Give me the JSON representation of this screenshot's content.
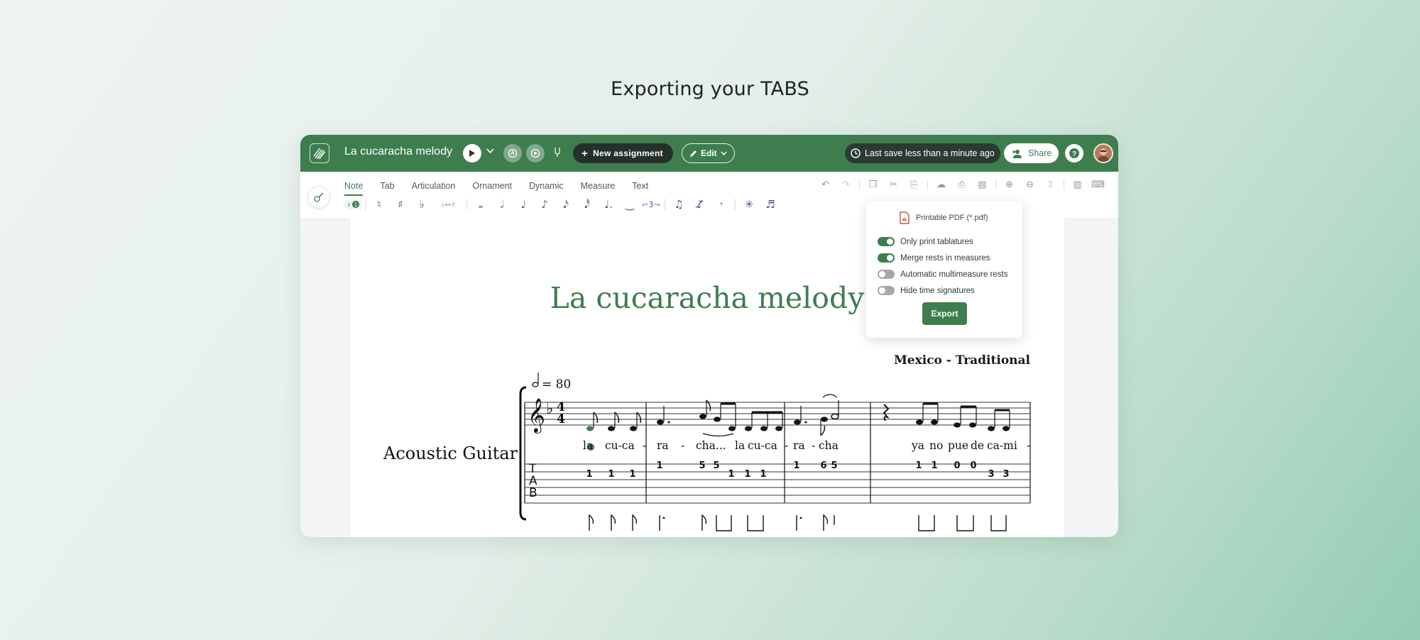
{
  "page": {
    "heading": "Exporting your TABS"
  },
  "app": {
    "doc_title": "La cucaracha melody",
    "new_assignment_label": "New assignment",
    "edit_label": "Edit",
    "save_status": "Last save less than a minute ago",
    "share_label": "Share",
    "accent_color": "#3e7d4e"
  },
  "toolbar": {
    "tabs": [
      "Note",
      "Tab",
      "Articulation",
      "Ornament",
      "Dynamic",
      "Measure",
      "Text"
    ],
    "active_tab": "Note",
    "voice_number": "1"
  },
  "score": {
    "title": "La cucaracha melody",
    "composer": "Mexico - Traditional",
    "instrument": "Acoustic Guitar",
    "tempo": "= 80",
    "tab_letters": [
      "T",
      "A",
      "B"
    ],
    "lyrics": [
      "la",
      "cu-ca",
      "-",
      "ra",
      "-",
      "cha...",
      "la",
      "cu-ca",
      "-",
      "ra",
      "-",
      "cha",
      "ya",
      "no",
      "pue",
      "de",
      "ca-mi",
      "-"
    ],
    "tab_numbers": [
      "1",
      "1",
      "1",
      "1",
      "5",
      "5",
      "1",
      "1",
      "1",
      "1",
      "6",
      "5",
      "1",
      "1",
      "0",
      "0",
      "3",
      "3"
    ]
  },
  "export_menu": {
    "format_label": "Printable PDF (*.pdf)",
    "options": [
      {
        "label": "Only print tablatures",
        "on": true
      },
      {
        "label": "Merge rests in measures",
        "on": true
      },
      {
        "label": "Automatic multimeasure rests",
        "on": false
      },
      {
        "label": "Hide time signatures",
        "on": false
      }
    ],
    "export_label": "Export"
  }
}
